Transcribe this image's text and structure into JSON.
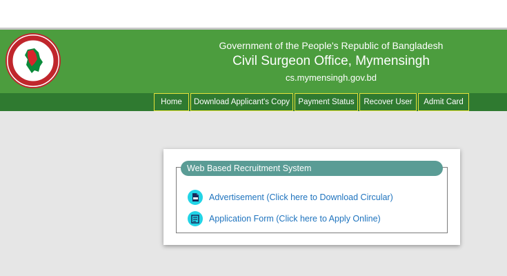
{
  "header": {
    "line1": "Government of the People's Republic of Bangladesh",
    "line2": "Civil Surgeon Office, Mymensingh",
    "line3": "cs.mymensingh.gov.bd",
    "logo_icon": "bangladesh-govt-seal-icon",
    "bg_color": "#4c9d3e"
  },
  "nav": {
    "items": [
      {
        "label": "Home"
      },
      {
        "label": "Download Applicant's Copy"
      },
      {
        "label": "Payment Status"
      },
      {
        "label": "Recover User"
      },
      {
        "label": "Admit Card"
      }
    ],
    "bg_color": "#2f7a30",
    "border_color": "#e6e33b"
  },
  "panel": {
    "legend": "Web Based Recruitment System",
    "links": [
      {
        "label": "Advertisement (Click here to Download Circular)",
        "icon": "pdf-icon"
      },
      {
        "label": "Application Form (Click here to Apply Online)",
        "icon": "form-icon"
      }
    ],
    "link_color": "#1e73be",
    "legend_color": "#5a9c95"
  }
}
